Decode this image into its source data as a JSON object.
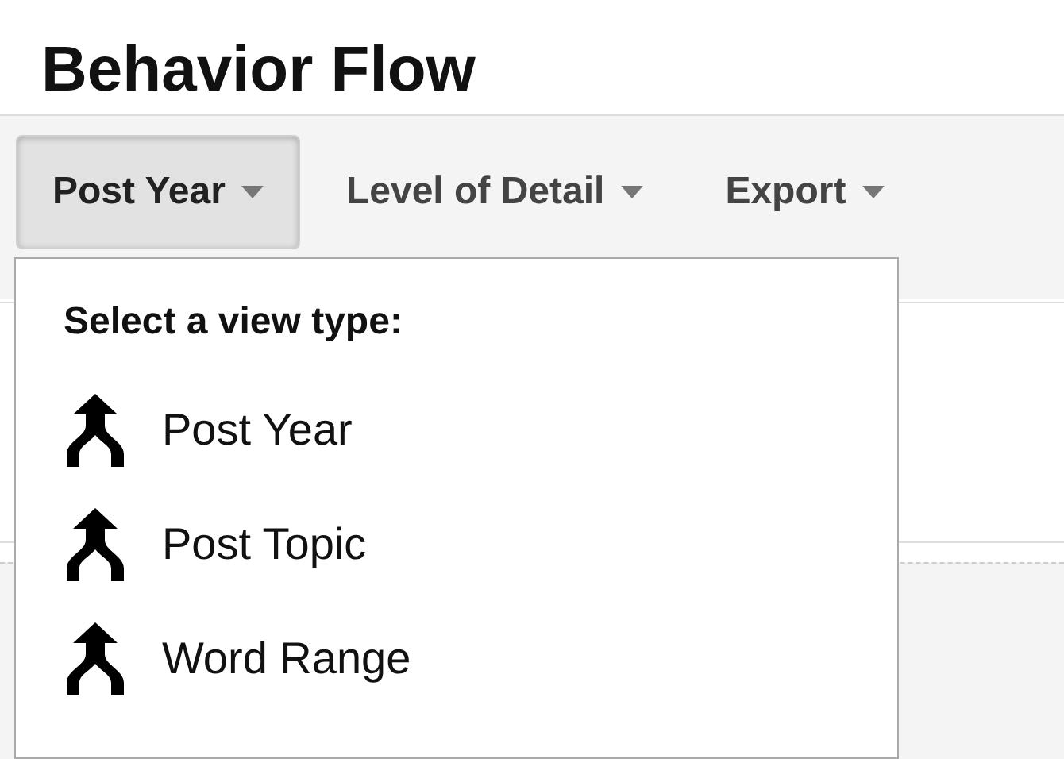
{
  "title": "Behavior Flow",
  "toolbar": [
    {
      "label": "Post Year",
      "selected": true
    },
    {
      "label": "Level of Detail",
      "selected": false
    },
    {
      "label": "Export",
      "selected": false
    }
  ],
  "dropdown": {
    "heading": "Select a view type:",
    "items": [
      {
        "label": "Post Year"
      },
      {
        "label": "Post Topic"
      },
      {
        "label": "Word Range"
      }
    ]
  }
}
